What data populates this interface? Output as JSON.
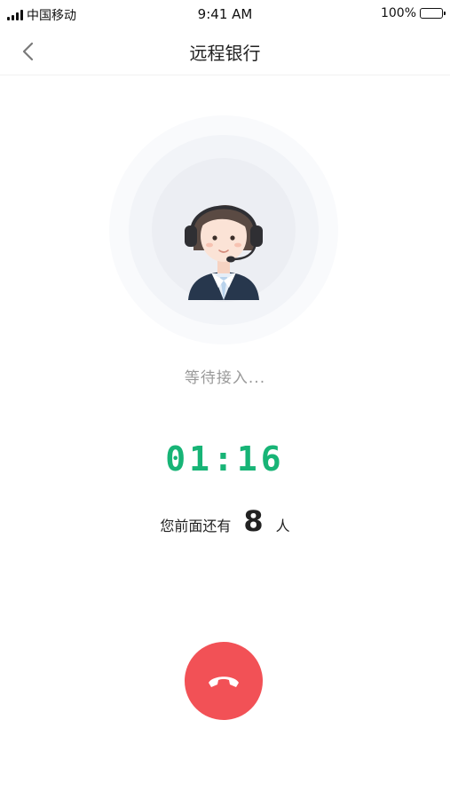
{
  "status_bar": {
    "carrier": "中国移动",
    "time": "9:41 AM",
    "battery": "100%"
  },
  "nav": {
    "back_icon": "chevron-left-icon",
    "title": "远程银行"
  },
  "call": {
    "avatar_icon": "customer-service-agent-icon",
    "status": "等待接入...",
    "timer": "01:16",
    "queue_prefix": "您前面还有",
    "queue_count": "8",
    "queue_suffix": "人",
    "hangup_icon": "phone-hangup-icon"
  },
  "colors": {
    "accent_green": "#17b476",
    "hangup_red": "#f25156",
    "muted_text": "#9a9a9a"
  }
}
